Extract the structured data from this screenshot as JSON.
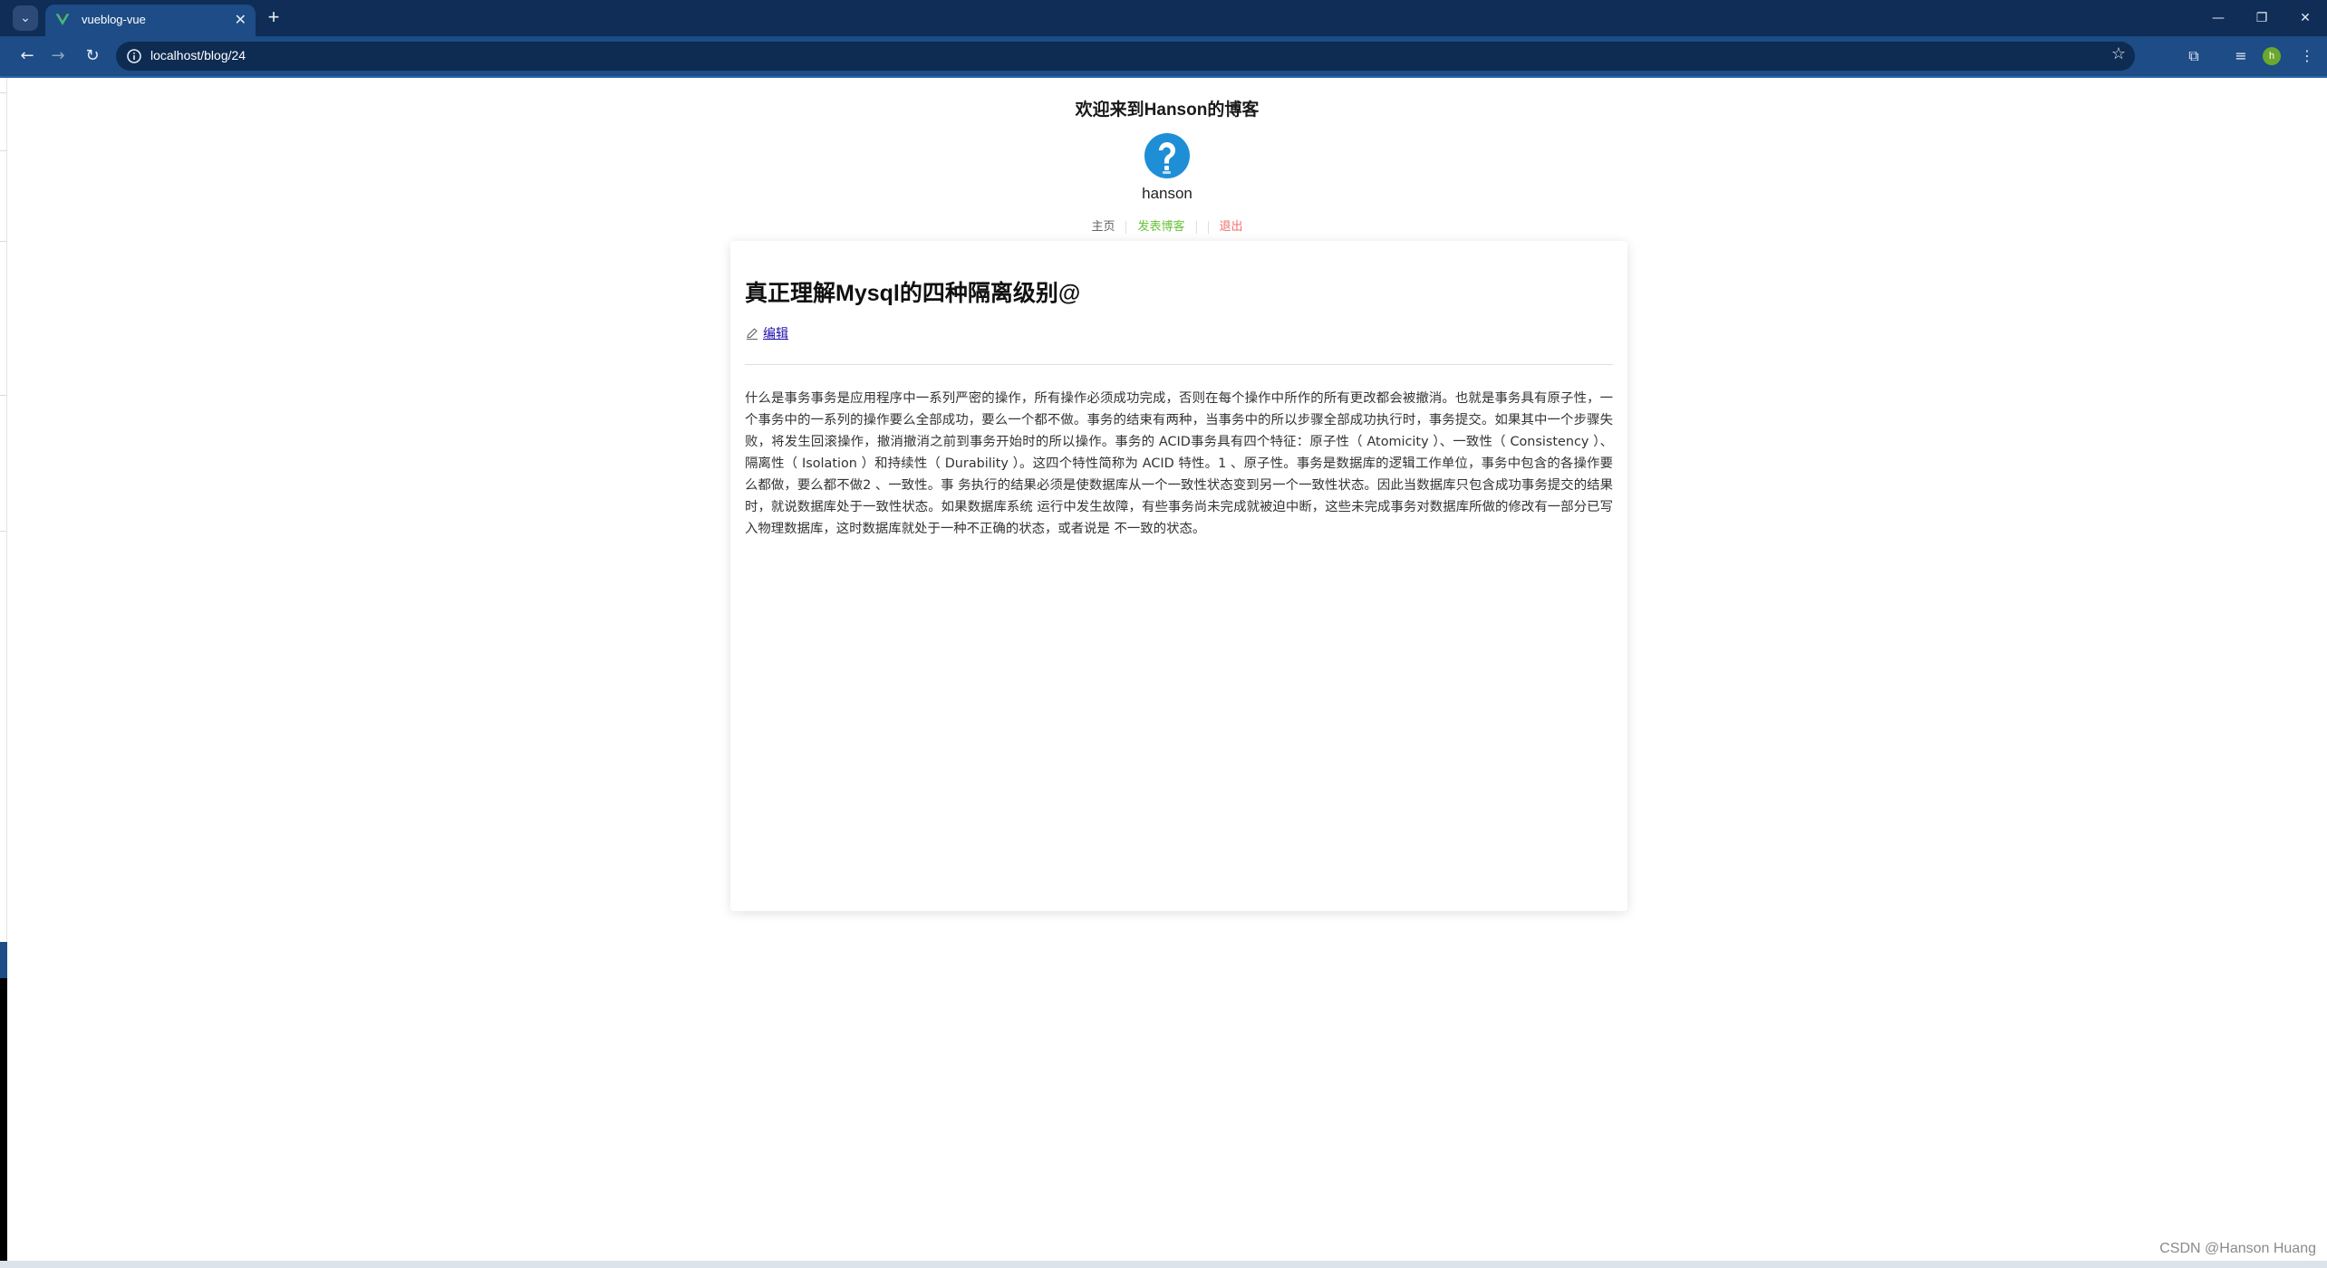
{
  "browser": {
    "tab_title": "vueblog-vue",
    "url": "localhost/blog/24",
    "profile_initial": "h"
  },
  "site": {
    "title": "欢迎来到Hanson的博客",
    "username": "hanson",
    "nav": {
      "home": "主页",
      "post": "发表博客",
      "logout": "退出"
    }
  },
  "blog": {
    "title": "真正理解Mysql的四种隔离级别@",
    "edit_label": "编辑",
    "content": "什么是事务事务是应用程序中一系列严密的操作，所有操作必须成功完成，否则在每个操作中所作的所有更改都会被撤消。也就是事务具有原子性，一个事务中的一系列的操作要么全部成功，要么一个都不做。事务的结束有两种，当事务中的所以步骤全部成功执行时，事务提交。如果其中一个步骤失败，将发生回滚操作，撤消撤消之前到事务开始时的所以操作。事务的 ACID事务具有四个特征：原子性（ Atomicity ）、一致性（ Consistency ）、隔离性（ Isolation ）和持续性（ Durability ）。这四个特性简称为 ACID 特性。1 、原子性。事务是数据库的逻辑工作单位，事务中包含的各操作要么都做，要么都不做2 、一致性。事 务执行的结果必须是使数据库从一个一致性状态变到另一个一致性状态。因此当数据库只包含成功事务提交的结果时，就说数据库处于一致性状态。如果数据库系统 运行中发生故障，有些事务尚未完成就被迫中断，这些未完成事务对数据库所做的修改有一部分已写入物理数据库，这时数据库就处于一种不正确的状态，或者说是 不一致的状态。"
  },
  "watermark": "CSDN @Hanson Huang",
  "colors": {
    "tab_strip": "#0f2d57",
    "toolbar": "#1d4c86",
    "nav_post": "#67c23a",
    "nav_logout": "#f56c6c",
    "avatar": "#1e8fd6"
  }
}
